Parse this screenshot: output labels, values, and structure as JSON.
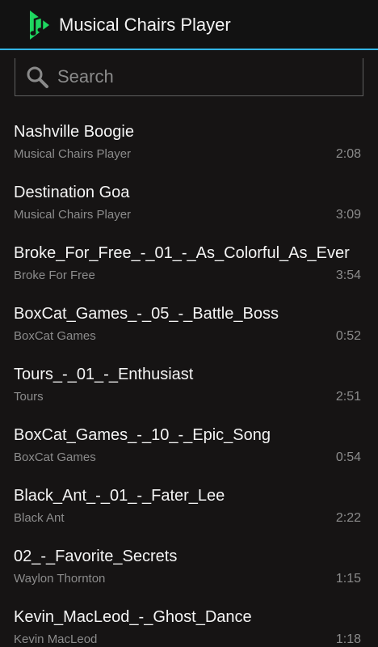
{
  "app": {
    "title": "Musical Chairs Player",
    "accent_color": "#33b5e5",
    "logo_color": "#1ed760",
    "logo_icon": "music-note-play-icon"
  },
  "search": {
    "placeholder": "Search",
    "value": "",
    "icon": "search-icon"
  },
  "tracks": [
    {
      "title": "Nashville Boogie",
      "artist": "Musical Chairs Player",
      "duration": "2:08"
    },
    {
      "title": "Destination Goa",
      "artist": "Musical Chairs Player",
      "duration": "3:09"
    },
    {
      "title": "Broke_For_Free_-_01_-_As_Colorful_As_Ever",
      "artist": "Broke For Free",
      "duration": "3:54"
    },
    {
      "title": "BoxCat_Games_-_05_-_Battle_Boss",
      "artist": "BoxCat Games",
      "duration": "0:52"
    },
    {
      "title": "Tours_-_01_-_Enthusiast",
      "artist": "Tours",
      "duration": "2:51"
    },
    {
      "title": "BoxCat_Games_-_10_-_Epic_Song",
      "artist": "BoxCat Games",
      "duration": "0:54"
    },
    {
      "title": "Black_Ant_-_01_-_Fater_Lee",
      "artist": "Black Ant",
      "duration": "2:22"
    },
    {
      "title": "02_-_Favorite_Secrets",
      "artist": "Waylon Thornton",
      "duration": "1:15"
    },
    {
      "title": "Kevin_MacLeod_-_Ghost_Dance",
      "artist": "Kevin MacLeod",
      "duration": "1:18"
    }
  ]
}
